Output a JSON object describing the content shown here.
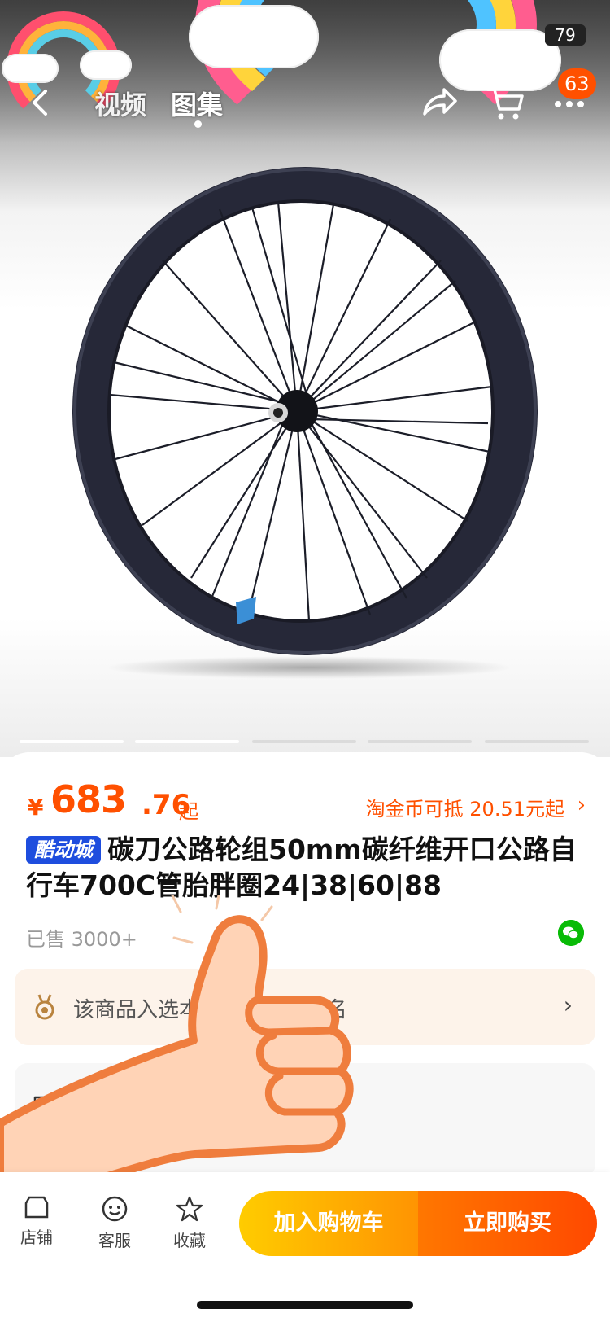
{
  "status": {
    "signal_number": "79"
  },
  "nav": {
    "tabs": [
      "视频",
      "图集"
    ],
    "active_tab": "图集",
    "cart_badge": "63"
  },
  "gallery": {
    "slide_count": 5,
    "active_slide": 1
  },
  "product": {
    "price_symbol": "¥",
    "price_integer": "683",
    "price_decimal": ".76",
    "price_suffix": "起",
    "coin_text": "淘金币可抵 20.51元起",
    "shop_tag": "酷动城",
    "title": "碳刀公路轮组50mm碳纤维开口公路自行车700C管胎胖圈24|38|60|88",
    "sold": "已售 3000+"
  },
  "rank": {
    "text": "该商品入选本店热卖榜·第1名"
  },
  "shipping": {
    "label": "福建"
  },
  "bottom_bar": {
    "shop_label": "店铺",
    "service_label": "客服",
    "favorite_label": "收藏",
    "add_to_cart": "加入购物车",
    "buy_now": "立即购买"
  },
  "colors": {
    "accent": "#ff5000",
    "cart_start": "#ffcc00",
    "buy_end": "#ff4900",
    "shop_tag": "#1e4dde"
  }
}
